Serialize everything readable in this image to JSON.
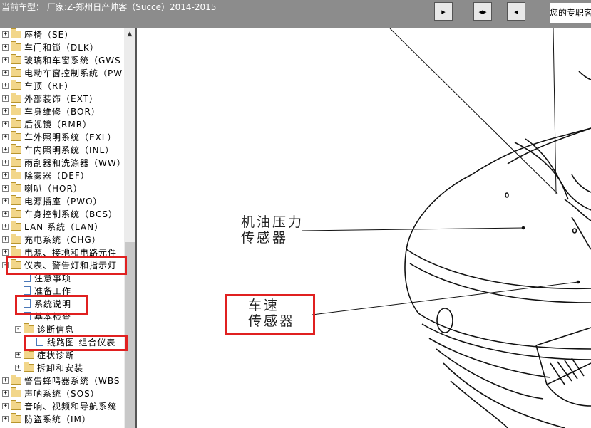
{
  "header": {
    "car_label": "当前车型： 厂家:Z-郑州日产帅客（Succe）2014-2015",
    "subscription_notice": "您的专职客",
    "buttons": [
      {
        "icon": "expand-right-icon",
        "glyph": "▸"
      },
      {
        "icon": "expand-both-icon",
        "glyph": "◂▸"
      },
      {
        "icon": "collapse-left-icon",
        "glyph": "◂"
      }
    ]
  },
  "tree": {
    "items": [
      {
        "label": "座椅（SE）",
        "type": "folder",
        "depth": 0,
        "expander": "+"
      },
      {
        "label": "车门和锁（DLK）",
        "type": "folder",
        "depth": 0,
        "expander": "+"
      },
      {
        "label": "玻璃和车窗系统（GWS",
        "type": "folder",
        "depth": 0,
        "expander": "+"
      },
      {
        "label": "电动车窗控制系统（PW",
        "type": "folder",
        "depth": 0,
        "expander": "+"
      },
      {
        "label": "车顶（RF）",
        "type": "folder",
        "depth": 0,
        "expander": "+"
      },
      {
        "label": "外部装饰（EXT）",
        "type": "folder",
        "depth": 0,
        "expander": "+"
      },
      {
        "label": "车身维修（BOR）",
        "type": "folder",
        "depth": 0,
        "expander": "+"
      },
      {
        "label": "后视镜（RMR）",
        "type": "folder",
        "depth": 0,
        "expander": "+"
      },
      {
        "label": "车外照明系统（EXL）",
        "type": "folder",
        "depth": 0,
        "expander": "+"
      },
      {
        "label": "车内照明系统（INL）",
        "type": "folder",
        "depth": 0,
        "expander": "+"
      },
      {
        "label": "雨刮器和洗涤器（WW）",
        "type": "folder",
        "depth": 0,
        "expander": "+"
      },
      {
        "label": "除雾器（DEF）",
        "type": "folder",
        "depth": 0,
        "expander": "+"
      },
      {
        "label": "喇叭（HOR）",
        "type": "folder",
        "depth": 0,
        "expander": "+"
      },
      {
        "label": "电源插座（PWO）",
        "type": "folder",
        "depth": 0,
        "expander": "+"
      },
      {
        "label": "车身控制系统（BCS）",
        "type": "folder",
        "depth": 0,
        "expander": "+"
      },
      {
        "label": "LAN 系统（LAN）",
        "type": "folder",
        "depth": 0,
        "expander": "+"
      },
      {
        "label": "充电系统（CHG）",
        "type": "folder",
        "depth": 0,
        "expander": "+"
      },
      {
        "label": "电源、接地和电路元件",
        "type": "folder",
        "depth": 0,
        "expander": "+"
      },
      {
        "label": "仪表、警告灯和指示灯",
        "type": "folder",
        "depth": 0,
        "expander": "-"
      },
      {
        "label": "注意事项",
        "type": "doc",
        "depth": 1,
        "expander": ""
      },
      {
        "label": "准备工作",
        "type": "doc",
        "depth": 1,
        "expander": ""
      },
      {
        "label": "系统说明",
        "type": "doc",
        "depth": 1,
        "expander": ""
      },
      {
        "label": "基本检查",
        "type": "doc",
        "depth": 1,
        "expander": ""
      },
      {
        "label": "诊断信息",
        "type": "folder",
        "depth": 1,
        "expander": "-"
      },
      {
        "label": "线路图-组合仪表",
        "type": "doc",
        "depth": 2,
        "expander": ""
      },
      {
        "label": "症状诊断",
        "type": "folder",
        "depth": 1,
        "expander": "+"
      },
      {
        "label": "拆卸和安装",
        "type": "folder",
        "depth": 1,
        "expander": "+"
      },
      {
        "label": "警告蜂鸣器系统（WBS",
        "type": "folder",
        "depth": 0,
        "expander": "+"
      },
      {
        "label": "声呐系统（SOS）",
        "type": "folder",
        "depth": 0,
        "expander": "+"
      },
      {
        "label": "音响、视频和导航系统",
        "type": "folder",
        "depth": 0,
        "expander": "+"
      },
      {
        "label": "防盗系统（IM）",
        "type": "folder",
        "depth": 0,
        "expander": "+"
      }
    ]
  },
  "diagram": {
    "oil_pressure_sensor_label": "机油压力\n传感器",
    "oil_line1": "机油压力",
    "oil_line2": "传感器",
    "speed_line1": "车速",
    "speed_line2": "传感器"
  },
  "colors": {
    "highlight_box": "#e02020",
    "topbar": "#8c8c8c"
  }
}
